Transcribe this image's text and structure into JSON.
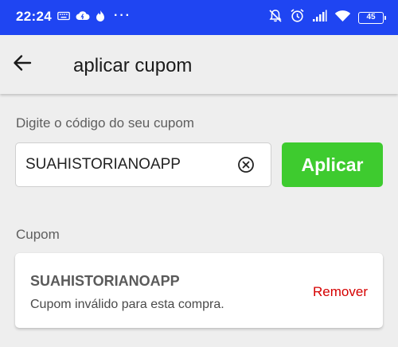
{
  "status_bar": {
    "time": "22:24",
    "left_icons": [
      "keyboard-icon",
      "cloud-icon",
      "flame-icon"
    ],
    "more_dots": "···",
    "right_icons": [
      "mute-icon",
      "alarm-icon",
      "signal-icon",
      "wifi-icon"
    ],
    "battery_level": "45"
  },
  "app_bar": {
    "title": "aplicar cupom"
  },
  "coupon_entry": {
    "label": "Digite o código do seu cupom",
    "value": "SUAHISTORIANOAPP",
    "apply_label": "Aplicar"
  },
  "applied_section": {
    "label": "Cupom",
    "code": "SUAHISTORIANOAPP",
    "message": "Cupom inválido para esta compra.",
    "remove_label": "Remover"
  },
  "colors": {
    "status_bar": "#1f45f2",
    "apply_button": "#3ecb2f",
    "remove_text": "#d50000",
    "background": "#eeeeee"
  }
}
